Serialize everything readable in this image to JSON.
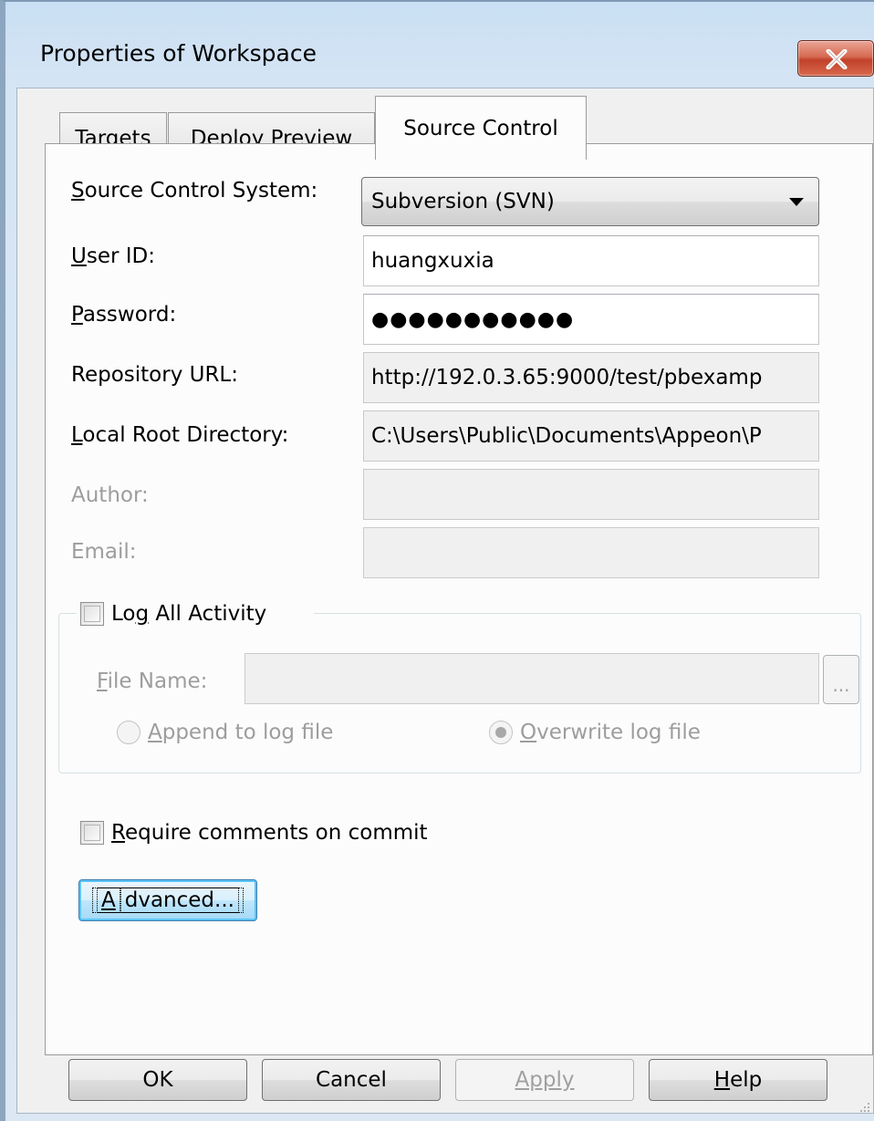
{
  "window": {
    "title": "Properties of Workspace"
  },
  "tabs": [
    {
      "label": "Targets",
      "active": false
    },
    {
      "label": "Deploy Preview",
      "active": false
    },
    {
      "label": "Source Control",
      "active": true
    }
  ],
  "form": {
    "source_control_system": {
      "label_underline": "S",
      "label_rest": "ource Control System:",
      "value": "Subversion (SVN)"
    },
    "user_id": {
      "label_underline": "U",
      "label_rest": "ser ID:",
      "value": "huangxuxia"
    },
    "password": {
      "label_underline": "P",
      "label_rest": "assword:",
      "value": "●●●●●●●●●●●"
    },
    "repository_url": {
      "label": "Repository URL:",
      "value": "http://192.0.3.65:9000/test/pbexamp"
    },
    "local_root": {
      "label_underline": "L",
      "label_rest": "ocal Root Directory:",
      "value": "C:\\Users\\Public\\Documents\\Appeon\\P"
    },
    "author": {
      "label": "Author:",
      "value": ""
    },
    "email": {
      "label": "Email:",
      "value": ""
    }
  },
  "log_group": {
    "checkbox_label_pre": "Lo",
    "checkbox_label_underline": "g",
    "checkbox_label_post": " All Activity",
    "checked": false,
    "file_name_label_underline": "F",
    "file_name_label_rest": "ile Name:",
    "file_name_value": "",
    "browse_label": "...",
    "append": {
      "label_underline": "A",
      "label_rest": "ppend to log file",
      "selected": false
    },
    "overwrite": {
      "label_underline": "O",
      "label_rest": "verwrite log file",
      "selected": true
    }
  },
  "require_comments": {
    "label_underline": "R",
    "label_rest": "equire comments on commit",
    "checked": false
  },
  "advanced_button": {
    "label_underline": "A",
    "label_rest": "dvanced..."
  },
  "footer": {
    "ok": "OK",
    "cancel": "Cancel",
    "apply": "Apply",
    "help_underline": "H",
    "help_rest": "elp"
  }
}
